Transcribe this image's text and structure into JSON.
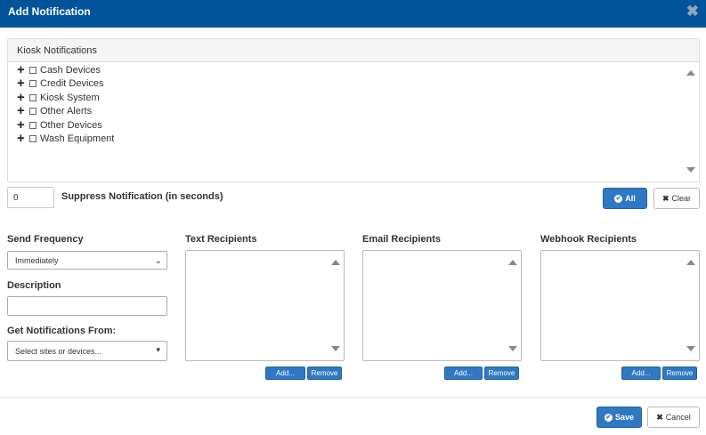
{
  "dialog": {
    "title": "Add Notification",
    "close_icon": "close-x-icon"
  },
  "tree": {
    "header": "Kiosk Notifications",
    "items": [
      {
        "label": "Cash Devices",
        "checked": false
      },
      {
        "label": "Credit Devices",
        "checked": false
      },
      {
        "label": "Kiosk System",
        "checked": false
      },
      {
        "label": "Other Alerts",
        "checked": false
      },
      {
        "label": "Other Devices",
        "checked": false
      },
      {
        "label": "Wash Equipment",
        "checked": false
      }
    ]
  },
  "suppress": {
    "value": "0",
    "label": "Suppress Notification (in seconds)"
  },
  "tree_buttons": {
    "all_label": "All",
    "clear_label": "Clear"
  },
  "form": {
    "send_frequency_label": "Send Frequency",
    "send_frequency_value": "Immediately",
    "description_label": "Description",
    "description_value": "",
    "get_from_label": "Get Notifications From:",
    "get_from_placeholder": "Select sites or devices..."
  },
  "recipients": {
    "text": {
      "label": "Text Recipients",
      "add": "Add...",
      "remove": "Remove"
    },
    "email": {
      "label": "Email Recipients",
      "add": "Add...",
      "remove": "Remove"
    },
    "webhook": {
      "label": "Webhook Recipients",
      "add": "Add...",
      "remove": "Remove"
    }
  },
  "footer": {
    "save_label": "Save",
    "cancel_label": "Cancel"
  },
  "colors": {
    "titlebar": "#01549a",
    "primary": "#2f78c4"
  }
}
